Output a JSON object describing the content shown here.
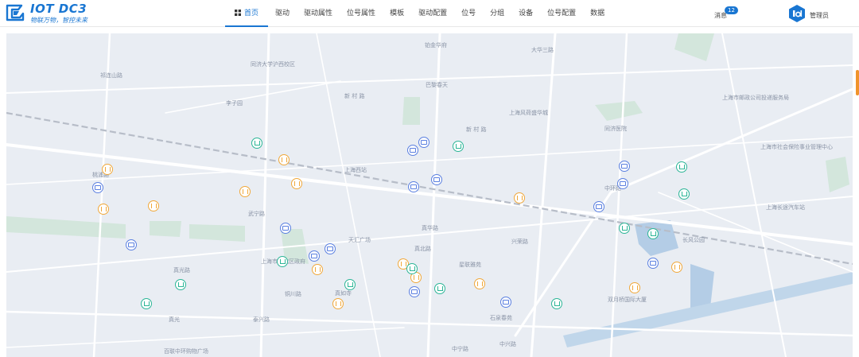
{
  "brand": {
    "title": "IOT DC3",
    "slogan": "物联万物，智控未来",
    "color": "#1976d2"
  },
  "nav": {
    "items": [
      {
        "label": "首页",
        "active": true
      },
      {
        "label": "驱动",
        "active": false
      },
      {
        "label": "驱动属性",
        "active": false
      },
      {
        "label": "位号属性",
        "active": false
      },
      {
        "label": "模板",
        "active": false
      },
      {
        "label": "驱动配置",
        "active": false
      },
      {
        "label": "位号",
        "active": false
      },
      {
        "label": "分组",
        "active": false
      },
      {
        "label": "设备",
        "active": false
      },
      {
        "label": "位号配置",
        "active": false
      },
      {
        "label": "数据",
        "active": false
      }
    ]
  },
  "header_right": {
    "messages_label": "消息",
    "messages_count": "12",
    "user_label": "管理员"
  },
  "map": {
    "labels": [
      {
        "text": "同济大学沪西校区"
      },
      {
        "text": "铂金华府"
      },
      {
        "text": "大华三路"
      },
      {
        "text": "巴黎春天"
      },
      {
        "text": "新 村 路"
      },
      {
        "text": "李子园"
      },
      {
        "text": "祁连山路"
      },
      {
        "text": "上海西站"
      },
      {
        "text": "上海风荷盛华城"
      },
      {
        "text": "新 村 路"
      },
      {
        "text": "同济医院"
      },
      {
        "text": "上海市邮政公司投递服务局"
      },
      {
        "text": "上海市社会保险事业管理中心"
      },
      {
        "text": "真华路"
      },
      {
        "text": "中环路"
      },
      {
        "text": "上海长途汽车站"
      },
      {
        "text": "真北路"
      },
      {
        "text": "天汇广场"
      },
      {
        "text": "兴荣路"
      },
      {
        "text": "星联雅苑"
      },
      {
        "text": "武宁路"
      },
      {
        "text": "长风公园"
      },
      {
        "text": "石泉春苑"
      },
      {
        "text": "中宁路"
      },
      {
        "text": "中兴路"
      },
      {
        "text": "真光路"
      },
      {
        "text": "铜川路"
      },
      {
        "text": "真如寺"
      },
      {
        "text": "桃浦路"
      },
      {
        "text": "百联中环购物广场"
      },
      {
        "text": "双月桥国际大厦"
      },
      {
        "text": "上海市普陀区政府"
      },
      {
        "text": "真光"
      },
      {
        "text": "泰兴路"
      }
    ],
    "markers": [
      {
        "type": "food"
      },
      {
        "type": "food"
      },
      {
        "type": "food"
      },
      {
        "type": "food"
      },
      {
        "type": "food"
      },
      {
        "type": "food"
      },
      {
        "type": "food"
      },
      {
        "type": "food"
      },
      {
        "type": "food"
      },
      {
        "type": "food"
      },
      {
        "type": "food"
      },
      {
        "type": "food"
      },
      {
        "type": "food"
      },
      {
        "type": "food"
      },
      {
        "type": "bus"
      },
      {
        "type": "bus"
      },
      {
        "type": "bus"
      },
      {
        "type": "bus"
      },
      {
        "type": "bus"
      },
      {
        "type": "bus"
      },
      {
        "type": "bus"
      },
      {
        "type": "bus"
      },
      {
        "type": "bus"
      },
      {
        "type": "bus"
      },
      {
        "type": "bus"
      },
      {
        "type": "bus"
      },
      {
        "type": "bus"
      },
      {
        "type": "bus"
      },
      {
        "type": "bus"
      },
      {
        "type": "bank"
      },
      {
        "type": "bank"
      },
      {
        "type": "bank"
      },
      {
        "type": "bank"
      },
      {
        "type": "bank"
      },
      {
        "type": "bank"
      },
      {
        "type": "bank"
      },
      {
        "type": "bank"
      },
      {
        "type": "bank"
      },
      {
        "type": "bank"
      },
      {
        "type": "bank"
      },
      {
        "type": "bank"
      },
      {
        "type": "bank"
      }
    ],
    "colors": {
      "food": "#f0a83a",
      "bus": "#5a7fe0",
      "bank": "#2bb596",
      "water": "#a9c7e3",
      "green": "#cfe3d8"
    }
  }
}
